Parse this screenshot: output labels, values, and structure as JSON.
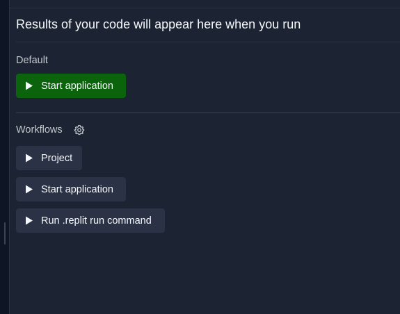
{
  "results_message": "Results of your code will appear here when you run",
  "default_section": {
    "label": "Default",
    "button_label": "Start application"
  },
  "workflows_section": {
    "label": "Workflows",
    "settings_icon": "gear-icon",
    "items": [
      {
        "label": "Project"
      },
      {
        "label": "Start application"
      },
      {
        "label": "Run .replit run command"
      }
    ]
  },
  "colors": {
    "background": "#1c2333",
    "primary_button": "#0b640b",
    "secondary_button": "#2b3245",
    "text": "#f5f9fc",
    "muted_text": "#c2c8cc"
  }
}
